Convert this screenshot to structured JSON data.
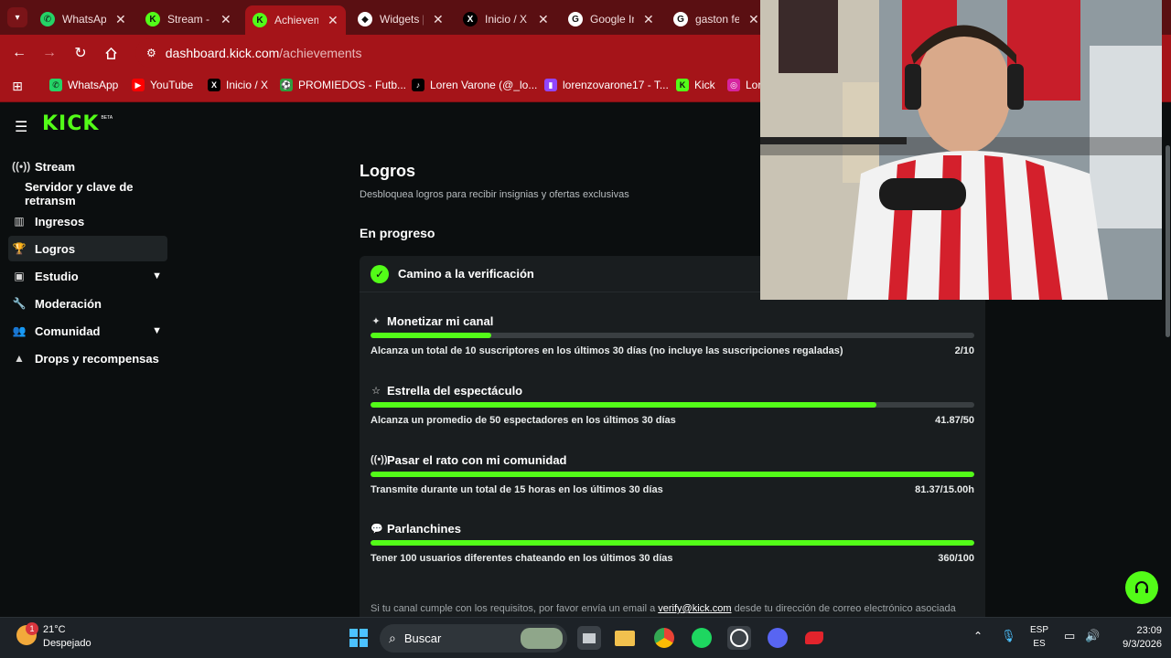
{
  "browser": {
    "tabs": [
      {
        "title": "WhatsApp",
        "icon": "whatsapp-icon",
        "color": "#25d366",
        "active": false
      },
      {
        "title": "Stream - K",
        "icon": "kick-icon",
        "color": "#53fc18",
        "active": false
      },
      {
        "title": "Achievem",
        "icon": "kick-icon",
        "color": "#53fc18",
        "active": true
      },
      {
        "title": "Widgets |",
        "icon": "widgets-icon",
        "color": "#ffffff",
        "active": false
      },
      {
        "title": "Inicio / X",
        "icon": "x-icon",
        "color": "#000000",
        "active": false
      },
      {
        "title": "Google In",
        "icon": "google-icon",
        "color": "#ffffff",
        "active": false
      },
      {
        "title": "gaston fe",
        "icon": "google-icon",
        "color": "#ffffff",
        "active": false
      }
    ],
    "url_host": "dashboard.kick.com",
    "url_path": "/achievements",
    "bookmarks": [
      {
        "label": "WhatsApp",
        "icon": "whatsapp-icon",
        "color": "#25d366"
      },
      {
        "label": "YouTube",
        "icon": "youtube-icon",
        "color": "#ff0000"
      },
      {
        "label": "Inicio / X",
        "icon": "x-icon",
        "color": "#000000"
      },
      {
        "label": "PROMIEDOS - Futb...",
        "icon": "promiedos-icon",
        "color": "#2e9e3e"
      },
      {
        "label": "Loren Varone (@_lo...",
        "icon": "tiktok-icon",
        "color": "#000000"
      },
      {
        "label": "lorenzovarone17 - T...",
        "icon": "twitch-icon",
        "color": "#9146ff"
      },
      {
        "label": "Kick",
        "icon": "kick-icon",
        "color": "#53fc18"
      },
      {
        "label": "Lor",
        "icon": "instagram-icon",
        "color": "#d6249f"
      }
    ]
  },
  "app": {
    "logo": "KICK",
    "logo_beta": "BETA",
    "accent": "#53fc18"
  },
  "sidebar": {
    "items": [
      {
        "label": "Stream",
        "icon": "stream-icon",
        "active": false,
        "expandable": false
      },
      {
        "label": "Servidor y clave de retransm",
        "icon": "",
        "active": false,
        "expandable": false
      },
      {
        "label": "Ingresos",
        "icon": "chart-icon",
        "active": false,
        "expandable": false
      },
      {
        "label": "Logros",
        "icon": "trophy-icon",
        "active": true,
        "expandable": false
      },
      {
        "label": "Estudio",
        "icon": "studio-icon",
        "active": false,
        "expandable": true
      },
      {
        "label": "Moderación",
        "icon": "wrench-icon",
        "active": false,
        "expandable": false
      },
      {
        "label": "Comunidad",
        "icon": "community-icon",
        "active": false,
        "expandable": true
      },
      {
        "label": "Drops y recompensas",
        "icon": "drops-icon",
        "active": false,
        "expandable": false
      }
    ]
  },
  "main": {
    "title": "Logros",
    "subtitle": "Desbloquea logros para recibir insignias y ofertas exclusivas",
    "section_title": "En progreso",
    "card_title": "Camino a la verificación",
    "goals": [
      {
        "title": "Monetizar mi canal",
        "icon": "sparkle-icon",
        "description": "Alcanza un total de 10 suscriptores en los últimos 30 días (no incluye las suscripciones regaladas)",
        "value": "2/10",
        "progress": 0.2
      },
      {
        "title": "Estrella del espectáculo",
        "icon": "viewers-icon",
        "description": "Alcanza un promedio de 50 espectadores en los últimos 30 días",
        "value": "41.87/50",
        "progress": 0.8374
      },
      {
        "title": "Pasar el rato con mi comunidad",
        "icon": "broadcast-icon",
        "description": "Transmite durante un total de 15 horas en los últimos 30 días",
        "value": "81.37/15.00h",
        "progress": 1.0
      },
      {
        "title": "Parlanchines",
        "icon": "chat-bubble-icon",
        "description": "Tener 100 usuarios diferentes chateando en los últimos 30 días",
        "value": "360/100",
        "progress": 1.0
      }
    ],
    "footer_before": "Si tu canal cumple con los requisitos, por favor envía un email a ",
    "footer_email": "verify@kick.com",
    "footer_after": " desde tu dirección de correo electrónico asociada"
  },
  "taskbar": {
    "weather_temp": "21°C",
    "weather_desc": "Despejado",
    "weather_badge": "1",
    "search_placeholder": "Buscar",
    "lang_primary": "ESP",
    "lang_secondary": "ES",
    "time": "23:09",
    "date": "9/3/2026"
  }
}
